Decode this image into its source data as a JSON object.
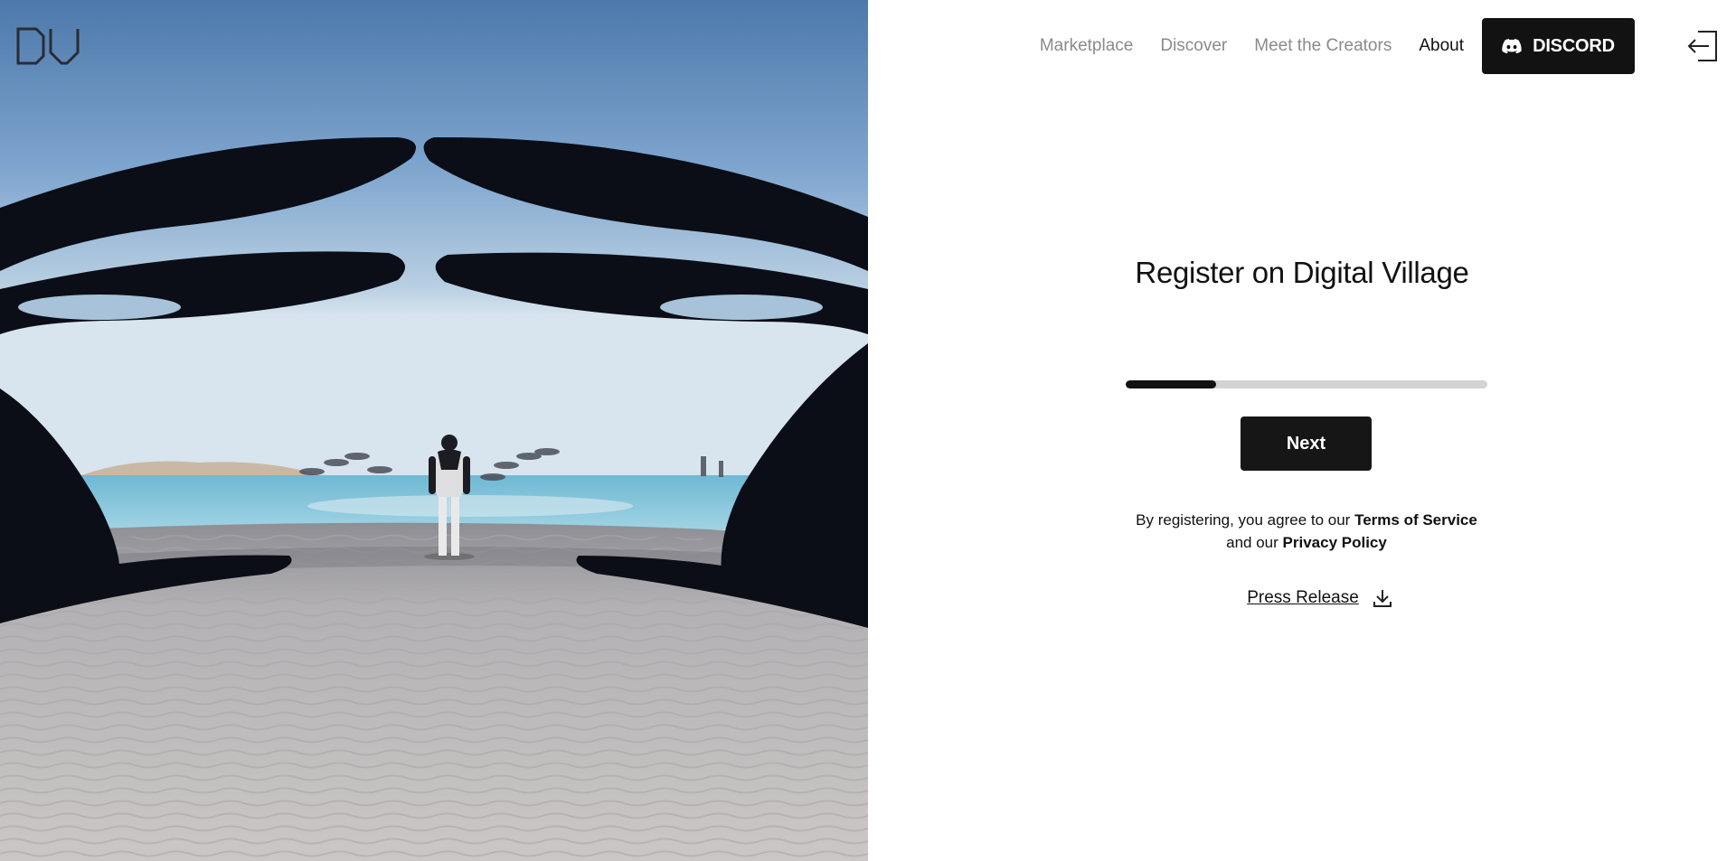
{
  "brand": {
    "logo_text": "DV"
  },
  "nav": {
    "links": [
      {
        "label": "Marketplace"
      },
      {
        "label": "Discover"
      },
      {
        "label": "Meet the Creators"
      },
      {
        "label": "About"
      }
    ],
    "discord_label": "DISCORD",
    "login_icon": "login-icon"
  },
  "register": {
    "title": "Register on Digital Village",
    "progress": 0.25,
    "next_label": "Next",
    "terms_prefix": "By registering, you agree to our",
    "terms_link": "Terms of Service",
    "terms_middle": "and our",
    "privacy_link": "Privacy Policy",
    "press_label": "Press Release",
    "press_icon": "download-icon"
  },
  "colors": {
    "accent": "#111111",
    "nav_inactive": "#8a8a8a",
    "progress_track": "#d3d3d3"
  }
}
